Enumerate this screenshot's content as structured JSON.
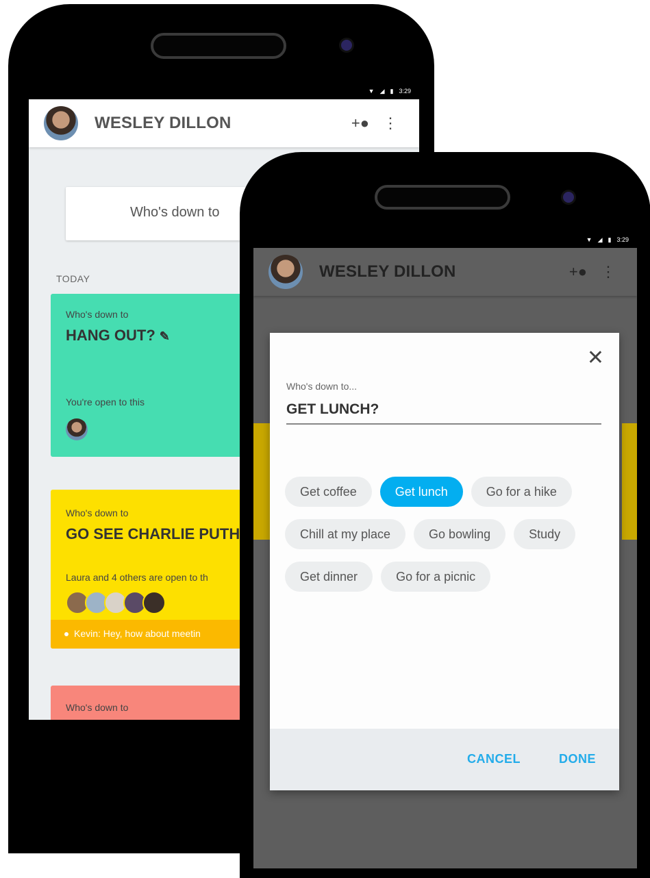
{
  "back_screen": {
    "status": {
      "time": "3:29"
    },
    "appbar": {
      "title": "WESLEY DILLON",
      "add_icon": "add-person-icon",
      "more_icon": "more-vert-icon"
    },
    "prompt": "Who's down to",
    "section": "TODAY",
    "cards": {
      "green": {
        "small": "Who's down to",
        "big": "HANG OUT?",
        "status": "You're open to this",
        "color": "#46ddb1"
      },
      "yellow": {
        "small": "Who's down to",
        "big": "GO SEE CHARLIE PUTH (",
        "status": "Laura and 4 others are open to th",
        "message": "Kevin: Hey, how about meetin",
        "color": "#fde000"
      },
      "red": {
        "small": "Who's down to",
        "color": "#f8867b"
      }
    }
  },
  "front_screen": {
    "status": {
      "time": "3:29"
    },
    "appbar": {
      "title": "WESLEY DILLON",
      "add_icon": "add-person-icon",
      "more_icon": "more-vert-icon"
    },
    "dialog": {
      "label": "Who's down to...",
      "value": "GET LUNCH?",
      "chips_row1": [
        "Get coffee",
        "Get lunch",
        "Go for a hike"
      ],
      "chips_row2": [
        "Chill at my place",
        "Go bowling",
        "Study"
      ],
      "chips_row3": [
        "Get dinner",
        "Go for a picnic"
      ],
      "selected_chip": "Get lunch",
      "cancel": "CANCEL",
      "done": "DONE",
      "accent": "#03aef0"
    }
  }
}
